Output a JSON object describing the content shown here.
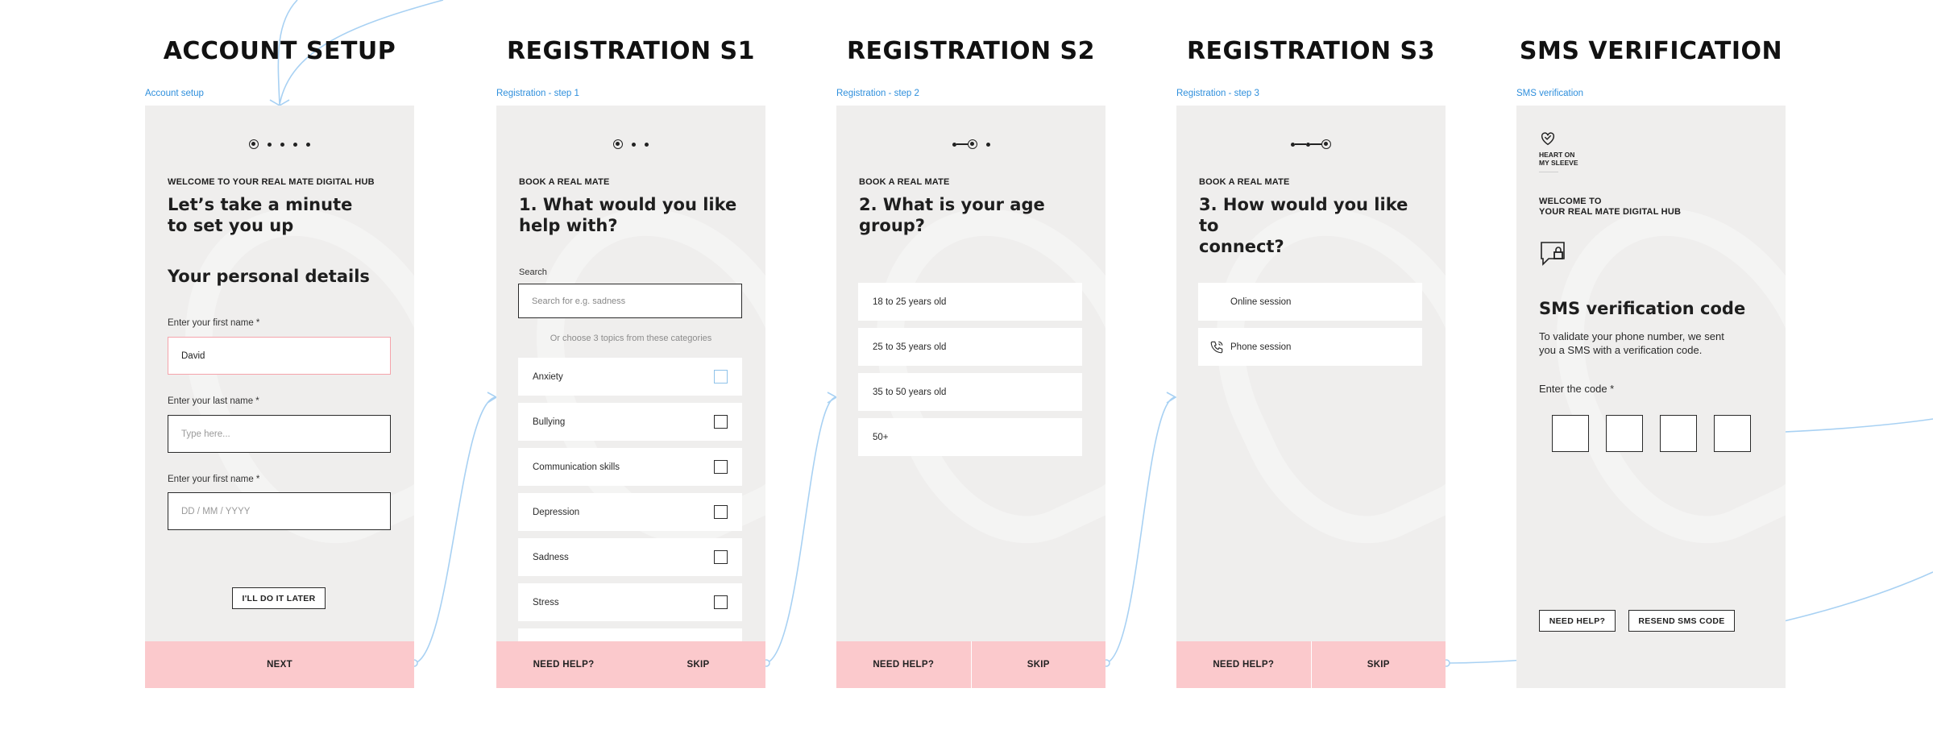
{
  "colors": {
    "accent_pink": "#fbc9cc",
    "link_blue": "#2f8fdc",
    "connector_blue": "#a8d1f3",
    "screen_bg": "#efeeed",
    "error_border": "#f5a3ab"
  },
  "titles": {
    "account_setup": "ACCOUNT SETUP",
    "registration_s1": "REGISTRATION S1",
    "registration_s2": "REGISTRATION S2",
    "registration_s3": "REGISTRATION S3",
    "sms_verification": "SMS VERIFICATION"
  },
  "frame_labels": {
    "account_setup": "Account setup",
    "registration_s1": "Registration - step 1",
    "registration_s2": "Registration - step 2",
    "registration_s3": "Registration - step 3",
    "sms_verification": "SMS verification"
  },
  "account_setup": {
    "overline": "WELCOME TO YOUR REAL MATE DIGITAL HUB",
    "heading_line1": "Let’s take a minute",
    "heading_line2": "to set you up",
    "section_title": "Your personal details",
    "first_name_label": "Enter your first name *",
    "first_name_value": "David",
    "last_name_label": "Enter your last name *",
    "last_name_placeholder": "Type here...",
    "dob_label": "Enter your first name *",
    "dob_placeholder": "DD  /  MM  /  YYYY",
    "later_button": "I'LL DO IT LATER",
    "next_button": "NEXT"
  },
  "registration_s1": {
    "overline": "BOOK A REAL MATE",
    "heading_line1": "1. What would you like",
    "heading_line2": "help with?",
    "search_label": "Search",
    "search_placeholder": "Search for e.g. sadness",
    "hint": "Or choose 3 topics from these categories",
    "topics": [
      "Anxiety",
      "Bullying",
      "Communication skills",
      "Depression",
      "Sadness",
      "Stress"
    ],
    "help_button": "NEED HELP?",
    "skip_button": "SKIP"
  },
  "registration_s2": {
    "overline": "BOOK A REAL MATE",
    "heading_line1": "2. What is your age",
    "heading_line2": "group?",
    "options": [
      "18 to 25 years old",
      "25 to 35 years old",
      "35 to 50 years old",
      "50+"
    ],
    "help_button": "NEED HELP?",
    "skip_button": "SKIP"
  },
  "registration_s3": {
    "overline": "BOOK A REAL MATE",
    "heading_line1": "3. How would you like to",
    "heading_line2": "connect?",
    "options": [
      "Online session",
      "Phone session"
    ],
    "help_button": "NEED HELP?",
    "skip_button": "SKIP"
  },
  "sms_verification": {
    "logo_line1": "HEART ON",
    "logo_line2": "MY SLEEVE",
    "welcome_line1": "WELCOME TO",
    "welcome_line2": "YOUR REAL MATE DIGITAL HUB",
    "heading": "SMS verification code",
    "body_line1": "To validate your phone number, we sent",
    "body_line2": "you a SMS with a verification code.",
    "code_label": "Enter the code *",
    "help_button": "NEED HELP?",
    "resend_button": "RESEND SMS CODE"
  }
}
